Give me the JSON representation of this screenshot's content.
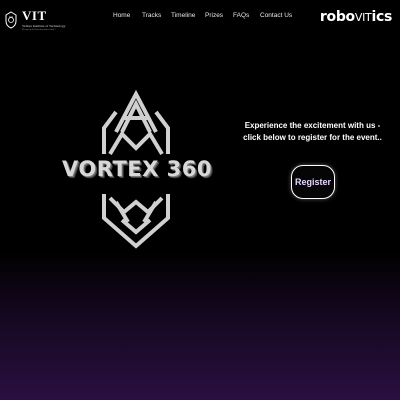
{
  "header": {
    "logo": {
      "name": "VIT",
      "subtitle": "Vellore Institute of Technology",
      "tagline": "(Deemed to be University under section 3 of UGC Act, 1956)"
    },
    "nav": [
      {
        "label": "Home"
      },
      {
        "label": "Tracks"
      },
      {
        "label": "Timeline"
      },
      {
        "label": "Prizes"
      },
      {
        "label": "FAQs"
      },
      {
        "label": "Contact Us"
      }
    ],
    "brand": {
      "prefix": "robo",
      "accent": "VIT",
      "suffix": "ics"
    }
  },
  "hero": {
    "title": "VORTEX 360",
    "tagline_line1": "Experience the excitement with us -",
    "tagline_line2": "click below to register for the event..",
    "register_label": "Register"
  },
  "colors": {
    "background_top": "#000000",
    "background_bottom": "#2a0f40",
    "text": "#ffffff",
    "emblem": "#d0d0d0",
    "register_text": "#e7d7ff"
  },
  "icons": {
    "vit_emblem": "vit-emblem-icon",
    "vortex_emblem": "vortex-emblem-icon"
  }
}
